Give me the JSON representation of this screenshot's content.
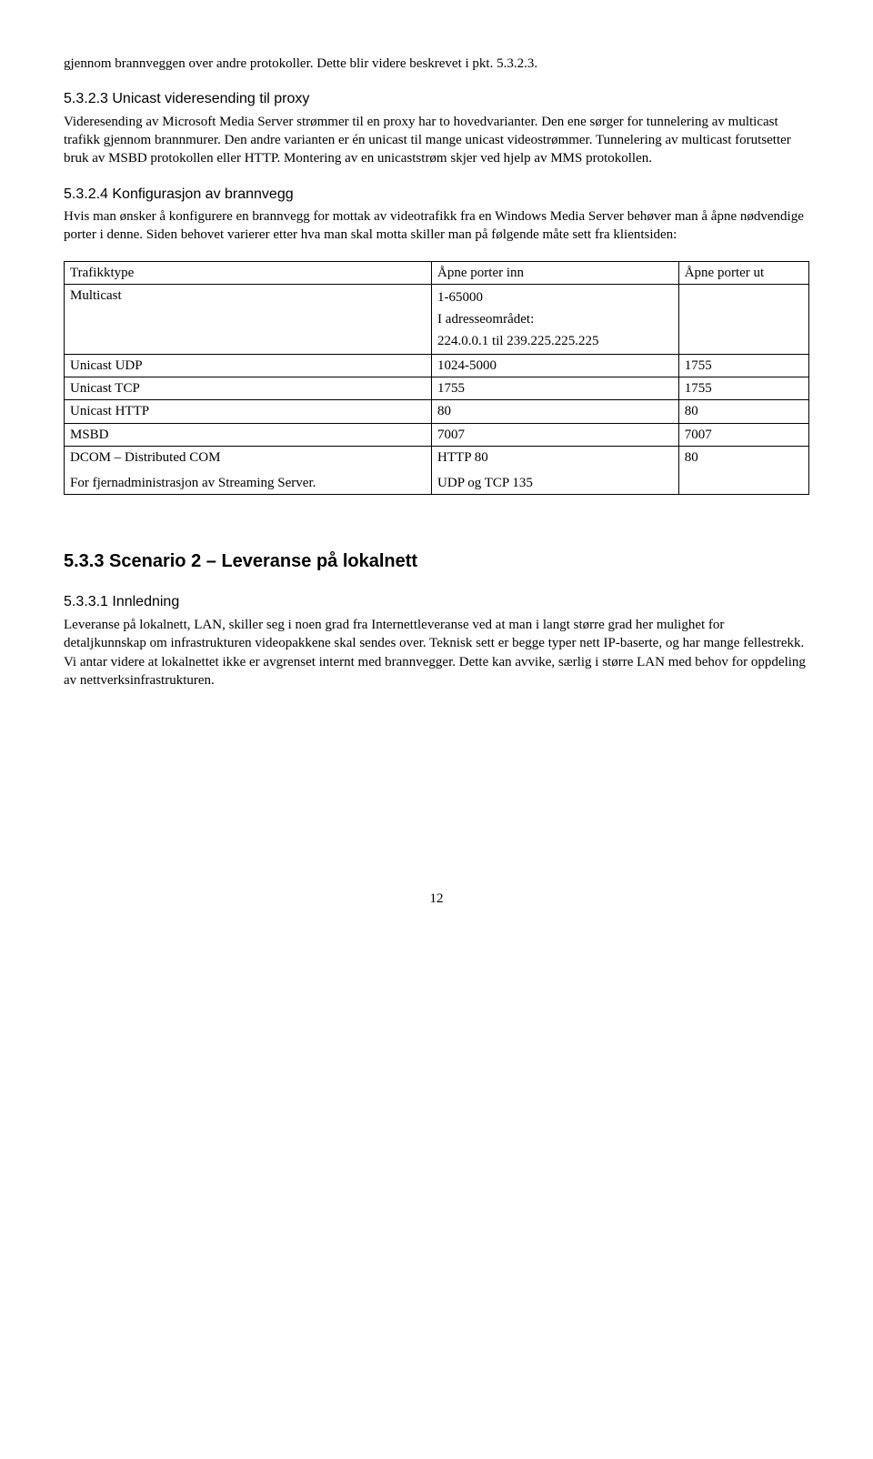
{
  "intro": {
    "p1": "gjennom brannveggen over andre protokoller. Dette blir videre beskrevet i pkt. 5.3.2.3."
  },
  "sec523": {
    "heading": "5.3.2.3 Unicast videresending til proxy",
    "body": "Videresending av Microsoft Media Server strømmer til en proxy har to hovedvarianter. Den ene sørger for tunnelering av multicast trafikk gjennom brannmurer. Den andre varianten er én unicast til mange unicast videostrømmer. Tunnelering av multicast forutsetter bruk av MSBD protokollen eller HTTP. Montering av en unicaststrøm skjer ved hjelp av MMS protokollen."
  },
  "sec524": {
    "heading": "5.3.2.4 Konfigurasjon av brannvegg",
    "body": "Hvis man ønsker å konfigurere en brannvegg for mottak av videotrafikk fra en Windows Media Server behøver man å åpne nødvendige porter i denne. Siden behovet varierer etter hva man skal motta skiller man på følgende måte sett fra klientsiden:"
  },
  "table": {
    "headers": {
      "col1": "Trafikktype",
      "col2": "Åpne porter inn",
      "col3": "Åpne porter ut"
    },
    "rows": {
      "multicast": {
        "c1": "Multicast",
        "c2a": " 1-65000",
        "c2b": "I adresseområdet:",
        "c2c": "224.0.0.1 til 239.225.225.225",
        "c3": ""
      },
      "uudp": {
        "c1": "Unicast UDP",
        "c2": "1024-5000",
        "c3": "1755"
      },
      "utcp": {
        "c1": "Unicast TCP",
        "c2": "1755",
        "c3": "1755"
      },
      "uhttp": {
        "c1": "Unicast HTTP",
        "c2": "80",
        "c3": "80"
      },
      "msbd": {
        "c1": "MSBD",
        "c2": "7007",
        "c3": "7007"
      },
      "dcom": {
        "c1a": "DCOM – Distributed COM",
        "c1b": "For fjernadministrasjon av Streaming Server.",
        "c2a": "HTTP 80",
        "c2b": "UDP og TCP 135",
        "c3": "80"
      }
    }
  },
  "sec533": {
    "heading": "5.3.3 Scenario 2 – Leveranse på lokalnett"
  },
  "sec5331": {
    "heading": "5.3.3.1 Innledning",
    "body": "Leveranse på lokalnett, LAN, skiller seg i noen grad fra Internettleveranse ved at man i langt større grad her mulighet for detaljkunnskap om infrastrukturen videopakkene skal sendes over. Teknisk sett er begge typer nett IP-baserte, og har mange fellestrekk. Vi antar videre at lokalnettet ikke er avgrenset internt med brannvegger. Dette kan avvike, særlig i større LAN med behov for oppdeling av nettverksinfrastrukturen."
  },
  "pagenum": "12"
}
